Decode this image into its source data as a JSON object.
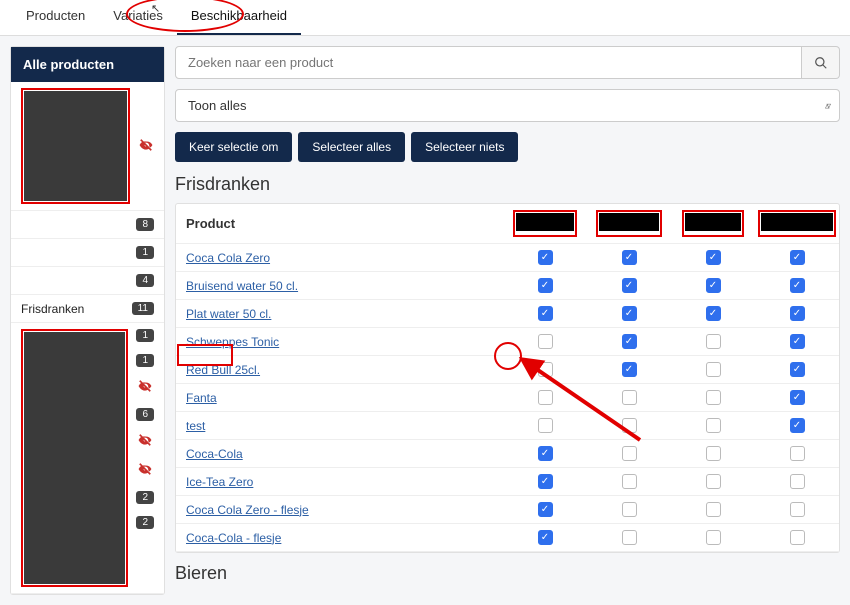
{
  "tabs": {
    "items": [
      {
        "label": "Producten",
        "active": false
      },
      {
        "label": "Variaties",
        "active": false
      },
      {
        "label": "Beschikbaarheid",
        "active": true
      }
    ]
  },
  "sidebar": {
    "header": "Alle producten",
    "rows": [
      {
        "type": "block-eye"
      },
      {
        "badge": "8"
      },
      {
        "badge": "1"
      },
      {
        "badge": "4"
      },
      {
        "label": "Frisdranken",
        "badge": "11"
      },
      {
        "type": "block-start",
        "badge": "1"
      },
      {
        "badge": "1"
      },
      {
        "type": "eye"
      },
      {
        "badge": "6"
      },
      {
        "type": "eye"
      },
      {
        "type": "eye"
      },
      {
        "badge": "2"
      },
      {
        "type": "block-end",
        "badge": "2"
      }
    ]
  },
  "search": {
    "placeholder": "Zoeken naar een product"
  },
  "filter": {
    "selected": "Toon alles"
  },
  "buttons": {
    "invert": "Keer selectie om",
    "all": "Selecteer alles",
    "none": "Selecteer niets"
  },
  "section1_title": "Frisdranken",
  "section2_title": "Bieren",
  "table": {
    "header_label": "Product",
    "rows": [
      {
        "name": "Coca Cola Zero",
        "c": [
          true,
          true,
          true,
          true
        ]
      },
      {
        "name": "Bruisend water 50 cl.",
        "c": [
          true,
          true,
          true,
          true
        ]
      },
      {
        "name": "Plat water 50 cl.",
        "c": [
          true,
          true,
          true,
          true
        ]
      },
      {
        "name": "Schweppes Tonic",
        "c": [
          false,
          true,
          false,
          true
        ]
      },
      {
        "name": "Red Bull 25cl.",
        "c": [
          false,
          true,
          false,
          true
        ]
      },
      {
        "name": "Fanta",
        "c": [
          false,
          false,
          false,
          true
        ]
      },
      {
        "name": "test",
        "c": [
          false,
          false,
          false,
          true
        ]
      },
      {
        "name": "Coca-Cola",
        "c": [
          true,
          false,
          false,
          false
        ]
      },
      {
        "name": "Ice-Tea Zero",
        "c": [
          true,
          false,
          false,
          false
        ]
      },
      {
        "name": "Coca Cola Zero - flesje",
        "c": [
          true,
          false,
          false,
          false
        ]
      },
      {
        "name": "Coca-Cola - flesje",
        "c": [
          true,
          false,
          false,
          false
        ]
      }
    ]
  }
}
